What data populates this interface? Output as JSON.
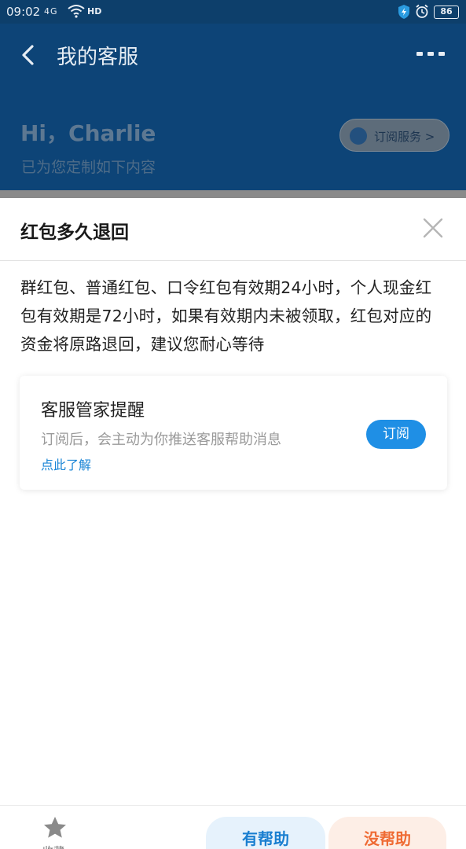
{
  "status_bar": {
    "time": "09:02",
    "network": "4G",
    "hd": "HD",
    "battery": "86",
    "icons": [
      "wifi-icon",
      "shield-icon",
      "alarm-icon",
      "battery-icon"
    ]
  },
  "header": {
    "title": "我的客服",
    "back_icon": "back-arrow-icon",
    "more_icon": "more-dots-icon",
    "background": "#0d4477"
  },
  "greeting": {
    "name": "Hi，Charlie",
    "subtitle": "已为您定制如下内容",
    "subscribe_pill": "订阅服务 >"
  },
  "sheet": {
    "title": "红包多久退回",
    "close_icon": "close-icon",
    "answer": "群红包、普通红包、口令红包有效期24小时，个人现金红包有效期是72小时，如果有效期内未被领取，红包对应的资金将原路退回，建议您耐心等待"
  },
  "reminder_card": {
    "title": "客服管家提醒",
    "description": "订阅后，会主动为你推送客服帮助消息",
    "link": "点此了解",
    "button": "订阅",
    "accent": "#1f8fe5"
  },
  "bottom_bar": {
    "favorite_label": "收藏",
    "favorite_icon": "star-icon",
    "helpful": "有帮助",
    "not_helpful": "没帮助",
    "helpful_color": "#1a7fd0",
    "not_helpful_color": "#ef6b34"
  }
}
